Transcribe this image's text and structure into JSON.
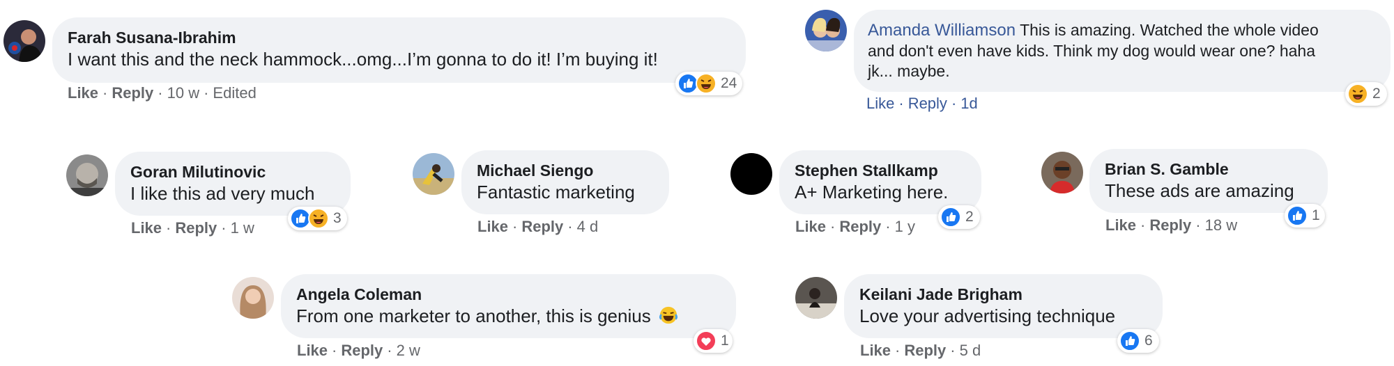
{
  "comments": [
    {
      "name": "Farah Susana-Ibrahim",
      "text": "I want this and the neck hammock...omg...I’m gonna to do it! I’m buying it!",
      "like": "Like",
      "reply": "Reply",
      "time": "10 w",
      "edited": "Edited",
      "reaction_count": "24"
    },
    {
      "name": "Amanda Williamson",
      "text_lines": [
        "This is amazing. Watched the whole video",
        "and don't even have kids. Think my dog would wear one? haha",
        "jk... maybe."
      ],
      "like": "Like",
      "reply": "Reply",
      "time": "1d",
      "reaction_count": "2"
    },
    {
      "name": "Goran Milutinovic",
      "text": "I like this ad very much",
      "like": "Like",
      "reply": "Reply",
      "time": "1 w",
      "reaction_count": "3"
    },
    {
      "name": "Michael Siengo",
      "text": "Fantastic marketing",
      "like": "Like",
      "reply": "Reply",
      "time": "4 d"
    },
    {
      "name": "Stephen Stallkamp",
      "text": "A+ Marketing here.",
      "like": "Like",
      "reply": "Reply",
      "time": "1 y",
      "reaction_count": "2"
    },
    {
      "name": "Brian S. Gamble",
      "text": "These ads are amazing",
      "like": "Like",
      "reply": "Reply",
      "time": "18 w",
      "reaction_count": "1"
    },
    {
      "name": "Angela Coleman",
      "text": "From one marketer to another, this is genius",
      "like": "Like",
      "reply": "Reply",
      "time": "2 w",
      "reaction_count": "1"
    },
    {
      "name": "Keilani Jade Brigham",
      "text": "Love your advertising technique",
      "like": "Like",
      "reply": "Reply",
      "time": "5 d",
      "reaction_count": "6"
    }
  ],
  "colors": {
    "bubble": "#f0f2f5",
    "name_link": "#385898",
    "meta": "#65676b",
    "like_blue": "#1877f2",
    "love_red": "#f33e58",
    "haha_yellow": "#f7b125"
  }
}
